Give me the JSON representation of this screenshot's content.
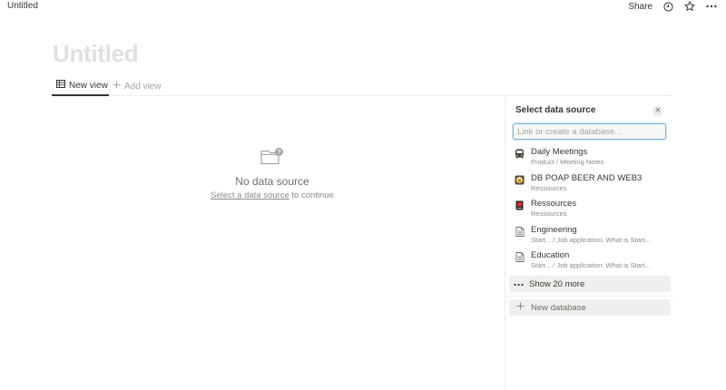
{
  "topbar": {
    "title": "Untitled",
    "share_label": "Share",
    "icons": [
      "clock-icon",
      "star-icon",
      "more-icon"
    ]
  },
  "page": {
    "title_placeholder": "Untitled"
  },
  "tabs": {
    "items": [
      {
        "label": "New view",
        "icon": "table-icon",
        "active": true
      },
      {
        "label": "Add view",
        "icon": "plus-icon",
        "active": false
      }
    ]
  },
  "empty_state": {
    "icon": "folder-question-icon",
    "headline": "No data source",
    "link_text": "Select a data source",
    "suffix": "to continue"
  },
  "panel": {
    "title": "Select data source",
    "close_icon": "close-icon",
    "search": {
      "placeholder": "Link or create a database...",
      "value": ""
    },
    "databases": [
      {
        "name": "Daily Meetings",
        "subtitle": "Product / Meeting Notes",
        "icon": "bus-icon"
      },
      {
        "name": "DB POAP BEER AND WEB3",
        "subtitle": "Ressources",
        "icon": "beer-icon"
      },
      {
        "name": "Ressources",
        "subtitle": "Ressources",
        "icon": "book-icon"
      },
      {
        "name": "Engineering",
        "subtitle": "Start... / Job application: What is Start...",
        "icon": "page-icon"
      },
      {
        "name": "Education",
        "subtitle": "Start... / Job application: What is Start...",
        "icon": "page-icon"
      }
    ],
    "show_more_label": "Show 20 more",
    "new_database_label": "New database"
  },
  "colors": {
    "text": "#37352f",
    "muted": "#8b8a86",
    "placeholder_title": "#e1e0de",
    "focus_ring": "#78b6d9",
    "row_highlight": "#efefed"
  }
}
